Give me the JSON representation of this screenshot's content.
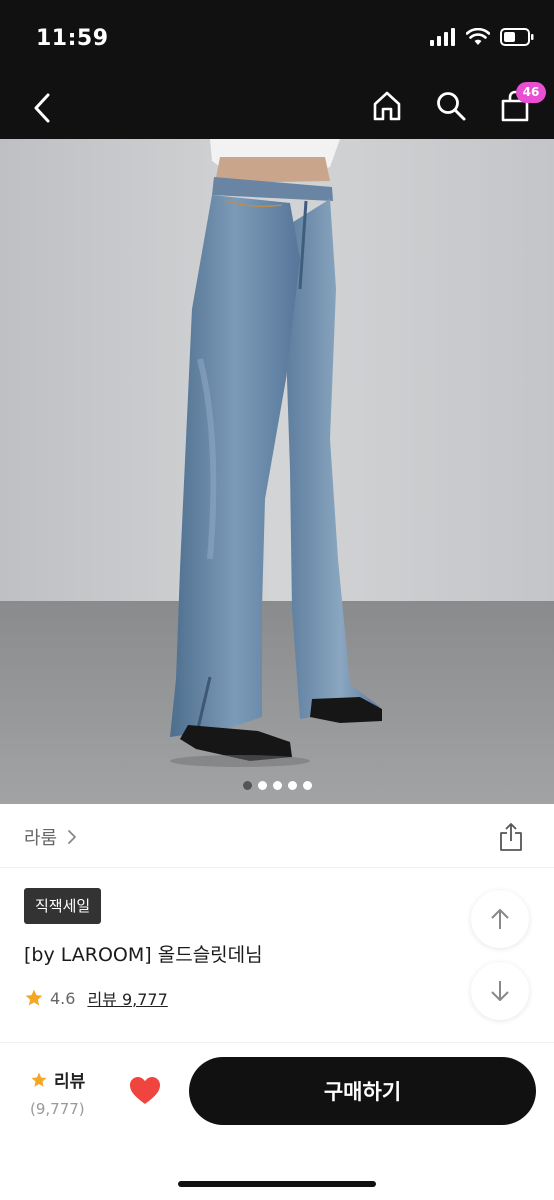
{
  "status_bar": {
    "time": "11:59"
  },
  "nav": {
    "cart_count": "46"
  },
  "image": {
    "dot_count": 5,
    "active_index": 0
  },
  "brand": {
    "name": "라룸",
    "chevron": "›"
  },
  "product": {
    "badge": "직잭세일",
    "title": "[by LAROOM] 올드슬릿데님",
    "rating": "4.6",
    "review_label": "리뷰 9,777"
  },
  "bottom_bar": {
    "review_label": "리뷰",
    "review_count": "(9,777)",
    "buy_label": "구매하기"
  },
  "colors": {
    "header_bg": "#111111",
    "badge_pink": "#e84fd3",
    "star": "#f5a623",
    "heart": "#f0443f"
  }
}
